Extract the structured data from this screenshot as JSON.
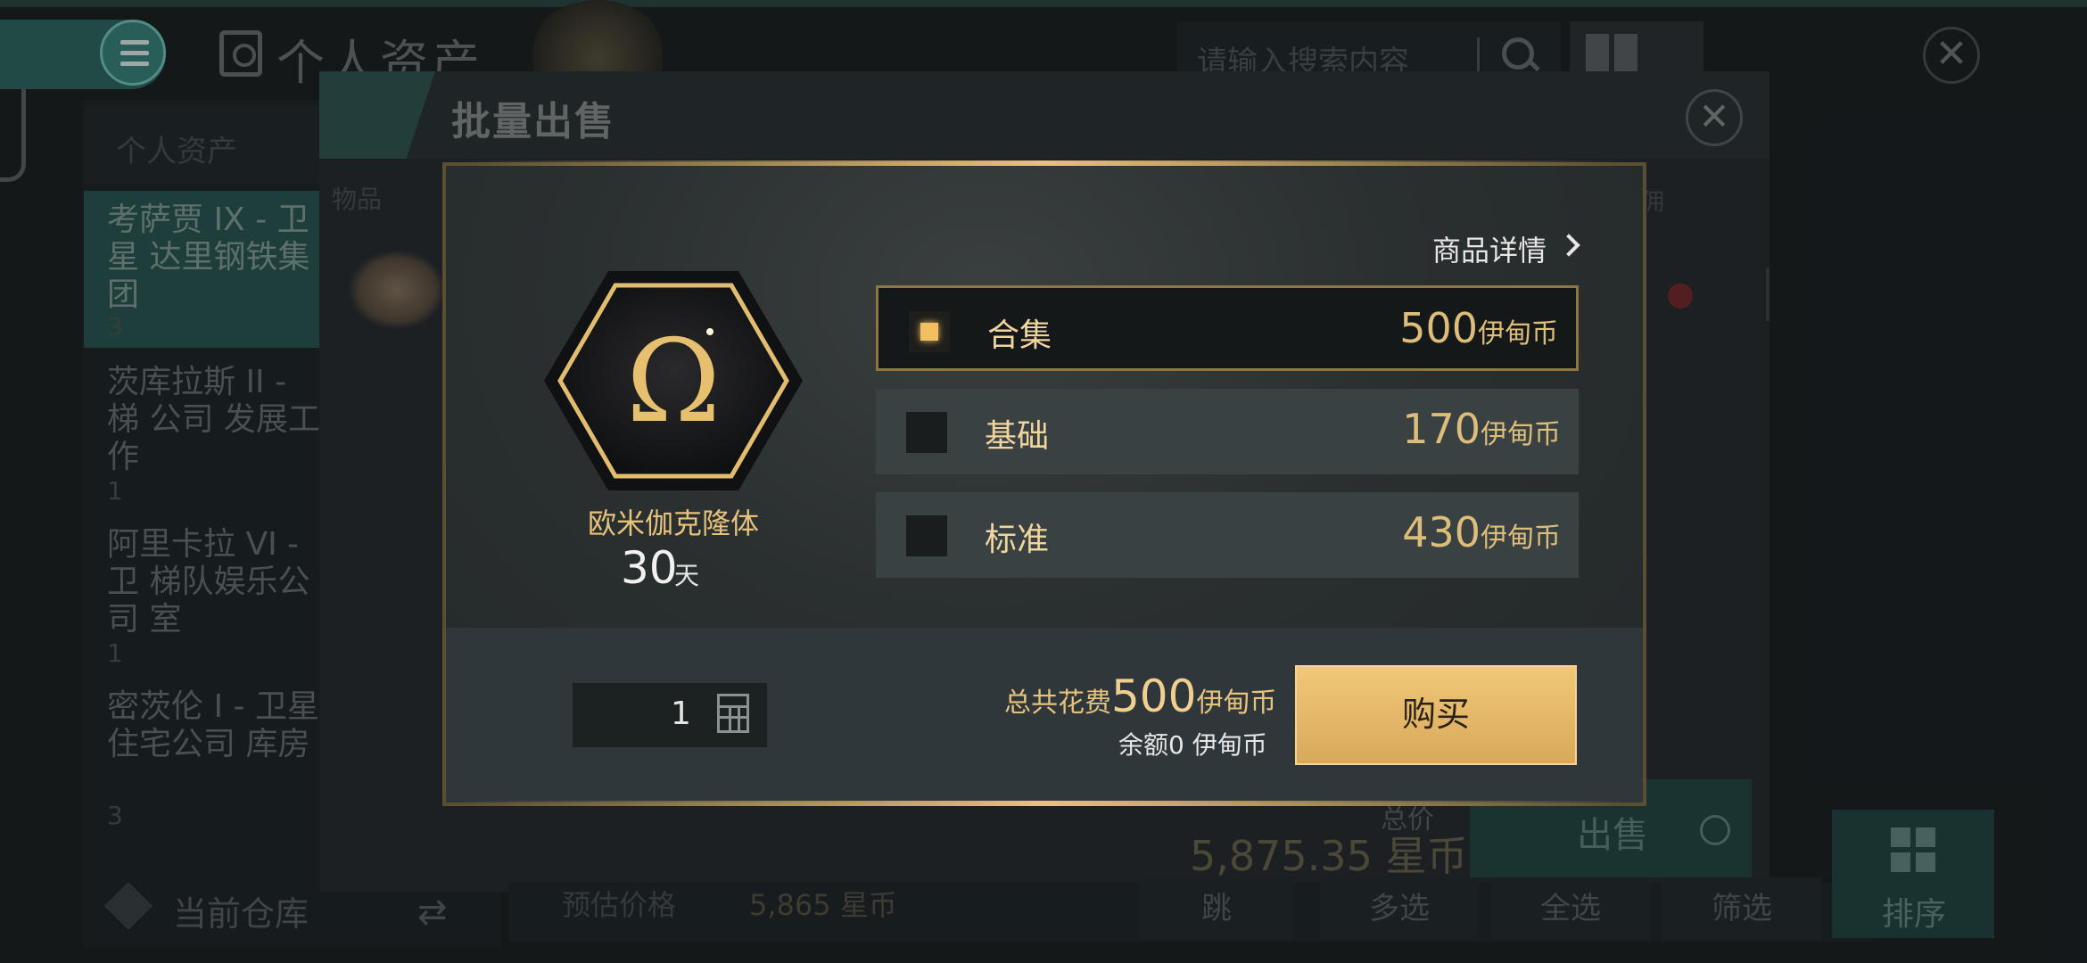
{
  "background": {
    "page_title": "个人资产",
    "search_placeholder": "请输入搜索内容",
    "close_glyph": "✕",
    "left_panel": {
      "header": "个人资产",
      "items": [
        {
          "label": "考萨贾 IX - 卫星 达里钢铁集团",
          "count": "3"
        },
        {
          "label": "茨库拉斯 II - 梯 公司 发展工作",
          "count": "1"
        },
        {
          "label": "阿里卡拉 VI - 卫 梯队娱乐公司 室",
          "count": "1"
        },
        {
          "label": "密茨伦 I - 卫星 住宅公司 库房",
          "count": "3"
        }
      ],
      "footer_label": "当前仓库",
      "swap_glyph": "⇄"
    },
    "dialog": {
      "title": "批量出售",
      "items_label": "物品",
      "right_label": "佣",
      "total_label": "总价",
      "total_value": "5,875.35 星币",
      "sell_label": "出售",
      "estimate_label": "预估价格",
      "estimate_value": "5,865 星币",
      "footer_buttons": [
        "跳",
        "多选",
        "全选",
        "筛选"
      ],
      "sort_label": "排序"
    }
  },
  "modal": {
    "details_link": "商品详情",
    "item": {
      "name": "欧米伽克隆体",
      "symbol": "Ω",
      "duration": "30",
      "duration_unit": "天"
    },
    "options": [
      {
        "name": "合集",
        "price": "500",
        "unit": "伊甸币",
        "selected": true
      },
      {
        "name": "基础",
        "price": "170",
        "unit": "伊甸币",
        "selected": false
      },
      {
        "name": "标准",
        "price": "430",
        "unit": "伊甸币",
        "selected": false
      }
    ],
    "quantity": "1",
    "total_prefix": "总共花费",
    "total_value": "500",
    "total_unit": "伊甸币",
    "balance_prefix": "余额",
    "balance_value": "0",
    "balance_unit": "伊甸币",
    "buy_label": "购买"
  },
  "colors": {
    "gold": "#e7c27d",
    "teal": "#2e6b64",
    "button_gold": "#f1c878"
  }
}
